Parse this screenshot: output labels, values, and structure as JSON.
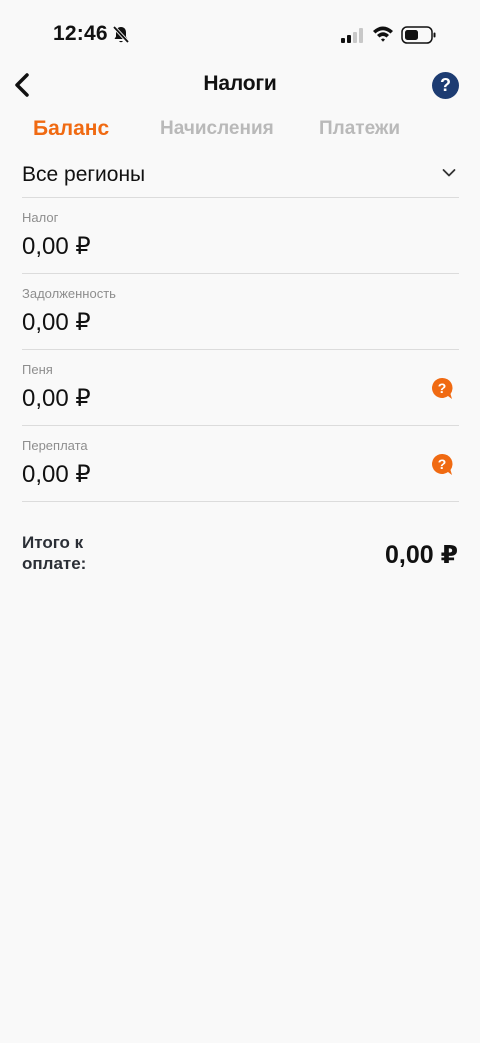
{
  "status_bar": {
    "time": "12:46"
  },
  "header": {
    "title": "Налоги",
    "help_label": "?"
  },
  "tabs": [
    {
      "label": "Баланс",
      "active": true
    },
    {
      "label": "Начисления",
      "active": false
    },
    {
      "label": "Платежи",
      "active": false
    }
  ],
  "region": {
    "selected": "Все регионы"
  },
  "rows": [
    {
      "label": "Налог",
      "value": "0,00 ₽"
    },
    {
      "label": "Задолженность",
      "value": "0,00 ₽"
    },
    {
      "label": "Пеня",
      "value": "0,00 ₽"
    },
    {
      "label": "Переплата",
      "value": "0,00 ₽"
    }
  ],
  "total": {
    "label": "Итого к оплате:",
    "value": "0,00 ₽"
  },
  "colors": {
    "accent": "#f06a12",
    "help_button": "#1d3c72",
    "inactive_tab": "#b9b9b9",
    "background": "#f9f9f9"
  },
  "icons": [
    "bell-slash-icon",
    "signal-icon",
    "wifi-icon",
    "battery-icon",
    "back-arrow-icon",
    "help-icon",
    "chevron-down-icon",
    "question-bubble-icon"
  ]
}
